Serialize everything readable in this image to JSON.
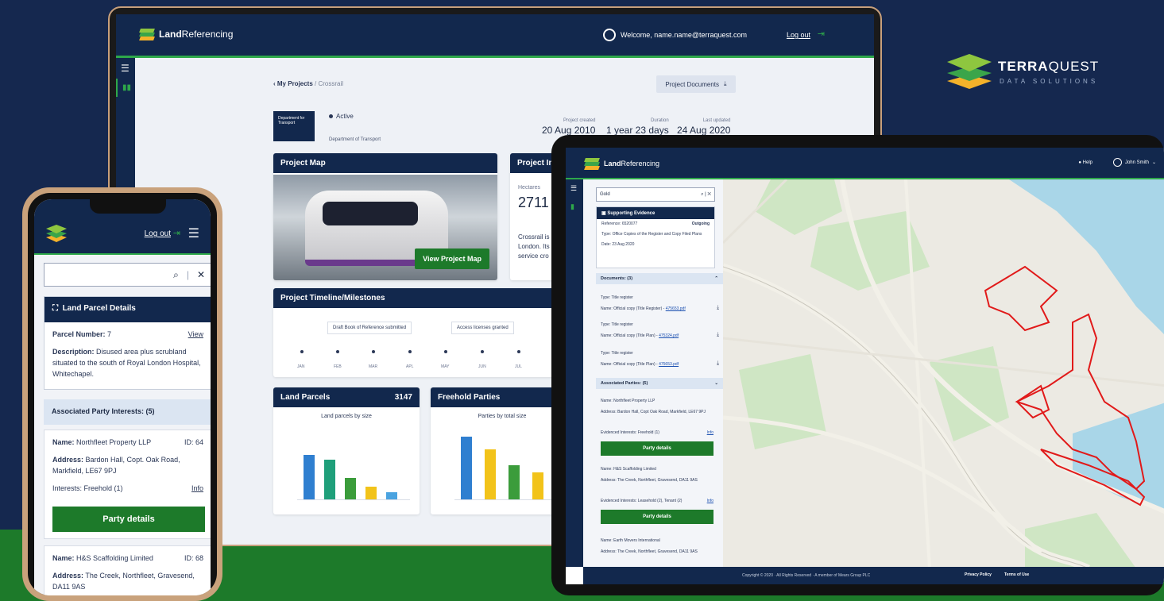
{
  "brand": {
    "word_bold": "TERRA",
    "word_rest": "QUEST",
    "tagline": "DATA SOLUTIONS"
  },
  "app": {
    "logo_bold": "Land",
    "logo_rest": "Referencing"
  },
  "laptop": {
    "welcome": "Welcome, name.name@terraquest.com",
    "logout": "Log out",
    "crumb_root": "My Projects",
    "crumb_sep": " / ",
    "crumb_current": "Crossrail",
    "docs_button": "Project Documents",
    "dept_badge": "Department for Transport",
    "status": "Active",
    "dept_name": "Department of Transport",
    "stats": [
      {
        "label": "Project created",
        "value": "20 Aug 2010"
      },
      {
        "label": "Duration",
        "value": "1 year 23 days"
      },
      {
        "label": "Last updated",
        "value": "24 Aug 2020"
      }
    ],
    "map_card_title": "Project Map",
    "view_map_button": "View Project Map",
    "info_card_title": "Project In",
    "info_label": "Hectares",
    "info_value": "2711",
    "info_text": "Crossrail is\nLondon. Its\nservice cro",
    "timeline_title": "Project Timeline/Milestones",
    "milestones": [
      "Draft Book of Reference submitted",
      "Access licenses granted"
    ],
    "months": [
      "JAN",
      "FEB",
      "MAR",
      "APL",
      "MAY",
      "JUN",
      "JUL"
    ],
    "parcels_title": "Land Parcels",
    "parcels_count": "3147",
    "parcels_chart_title": "Land parcels by size",
    "parcels_bars": [
      62,
      56,
      30,
      18,
      10
    ],
    "freehold_title": "Freehold Parties",
    "freehold_chart_title": "Parties by total size",
    "freehold_bars": [
      88,
      70,
      48,
      38
    ]
  },
  "tablet": {
    "help": "Help",
    "user": "John Smith",
    "search_value": "Gold",
    "evidence_title": "Supporting Evidence",
    "reference": "Reference: 6520077",
    "outgoing": "Outgoing",
    "type": "Type: Office Copies of the Register and Copy Filed Plans",
    "date": "Date: 23 Aug 2020",
    "documents_header": "Documents: (3)",
    "documents": [
      {
        "type": "Type: Title register",
        "name_label": "Name: Official copy (Title Register) -",
        "link": "475653.pdf"
      },
      {
        "type": "Type: Title register",
        "name_label": "Name: Official copy (Title Plan) -",
        "link": "475324.pdf"
      },
      {
        "type": "Type: Title register",
        "name_label": "Name: Official copy (Title Plan) -",
        "link": "475653.pdf"
      }
    ],
    "parties_header": "Associated Parties: (5)",
    "party1_name": "Name: Northfleet Property LLP",
    "party1_address": "Address: Bardon Hall, Copt Oak Road, Markfield, LE67 9PJ",
    "party1_interests": "Evidenced Interests: Freehold (1)",
    "party2_name": "Name: H&S Scaffolding Limited",
    "party2_address": "Address: The Creek, Northfleet, Gravesend, DA11 9AS",
    "party2_interests": "Evidenced Interests: Leasehold (2), Tenant (2)",
    "party3_name": "Name: Earth Movers International",
    "party3_address": "Address: The Creek, Northfleet, Gravesend, DA11 9AS",
    "info": "Info",
    "party_button": "Party details",
    "copyright": "Copyright © 2020 · All Rights Reserved · A member of Mears Group PLC",
    "privacy": "Privacy Policy",
    "terms": "Terms of Use"
  },
  "phone": {
    "logout": "Log out",
    "card_title": "Land Parcel Details",
    "parcel_label": "Parcel Number:",
    "parcel_value": "7",
    "view_link": "View",
    "desc_label": "Description:",
    "desc_value": "Disused area plus scrubland situated to the south of Royal London Hospital, Whitechapel.",
    "interests_header": "Associated Party Interests: (5)",
    "party1_name_label": "Name:",
    "party1_name": "Northfleet Property LLP",
    "party1_id": "ID: 64",
    "party1_address_label": "Address:",
    "party1_address": "Bardon Hall, Copt. Oak Road, Markfield, LE67 9PJ",
    "party1_interests": "Interests: Freehold (1)",
    "info_link": "Info",
    "party_button": "Party details",
    "party2_name_label": "Name:",
    "party2_name": "H&S Scaffolding Limited",
    "party2_id": "ID: 68",
    "party2_address_label": "Address:",
    "party2_address": "The Creek, Northfleet, Gravesend, DA11 9AS"
  },
  "colors": {
    "navy": "#12284d",
    "green": "#1d7a2a",
    "accent": "#2ea84a",
    "background": "#15284f"
  }
}
